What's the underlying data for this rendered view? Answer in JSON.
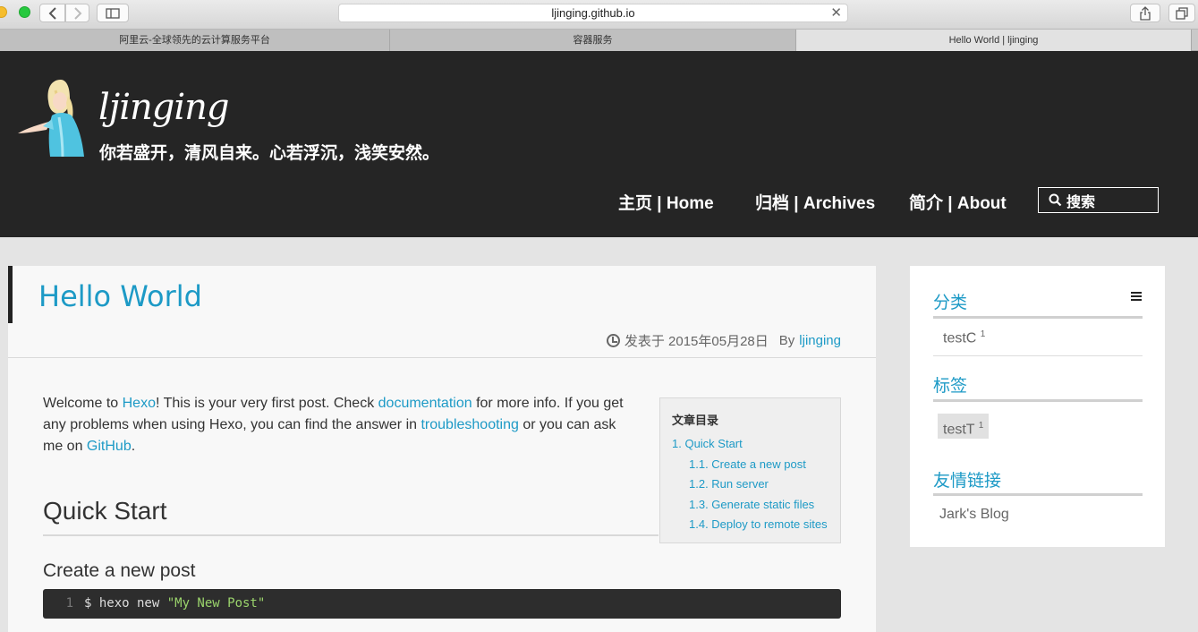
{
  "browser": {
    "url": "ljinging.github.io",
    "tabs": [
      {
        "label": "阿里云-全球领先的云计算服务平台"
      },
      {
        "label": "容器服务"
      },
      {
        "label": "Hello World | ljinging"
      }
    ]
  },
  "site": {
    "title": "ljinging",
    "subtitle": "你若盛开，清风自来。心若浮沉，浅笑安然。",
    "nav": {
      "home": "主页 | Home",
      "archives": "归档 | Archives",
      "about": "简介 | About",
      "search_placeholder": "搜索"
    }
  },
  "post": {
    "title": "Hello World",
    "date": "发表于 2015年05月28日",
    "by": "By",
    "author": "ljinging",
    "intro": {
      "p1": "Welcome to ",
      "link1": "Hexo",
      "p2": "! This is your very first post. Check ",
      "link2": "documentation",
      "p3": " for more info. If you get any problems when using Hexo, you can find the answer in ",
      "link3": "troubleshooting",
      "p4": " or you can ask me on ",
      "link4": "GitHub",
      "p5": "."
    },
    "h_quick_start": "Quick Start",
    "h_create_post": "Create a new post",
    "code": {
      "line_no": "1",
      "cmd": "$ hexo new ",
      "arg": "\"My New Post\""
    },
    "toc": {
      "title": "文章目录",
      "items": [
        "1. Quick Start",
        "1.1. Create a new post",
        "1.2. Run server",
        "1.3. Generate static files",
        "1.4. Deploy to remote sites"
      ]
    }
  },
  "sidebar": {
    "categories": {
      "heading": "分类",
      "item": "testC",
      "count": "1"
    },
    "tags": {
      "heading": "标签",
      "item": "testT",
      "count": "1"
    },
    "links": {
      "heading": "友情链接",
      "item": "Jark's Blog"
    }
  },
  "colors": {
    "accent": "#1d9ac6",
    "header_bg": "#252525"
  }
}
